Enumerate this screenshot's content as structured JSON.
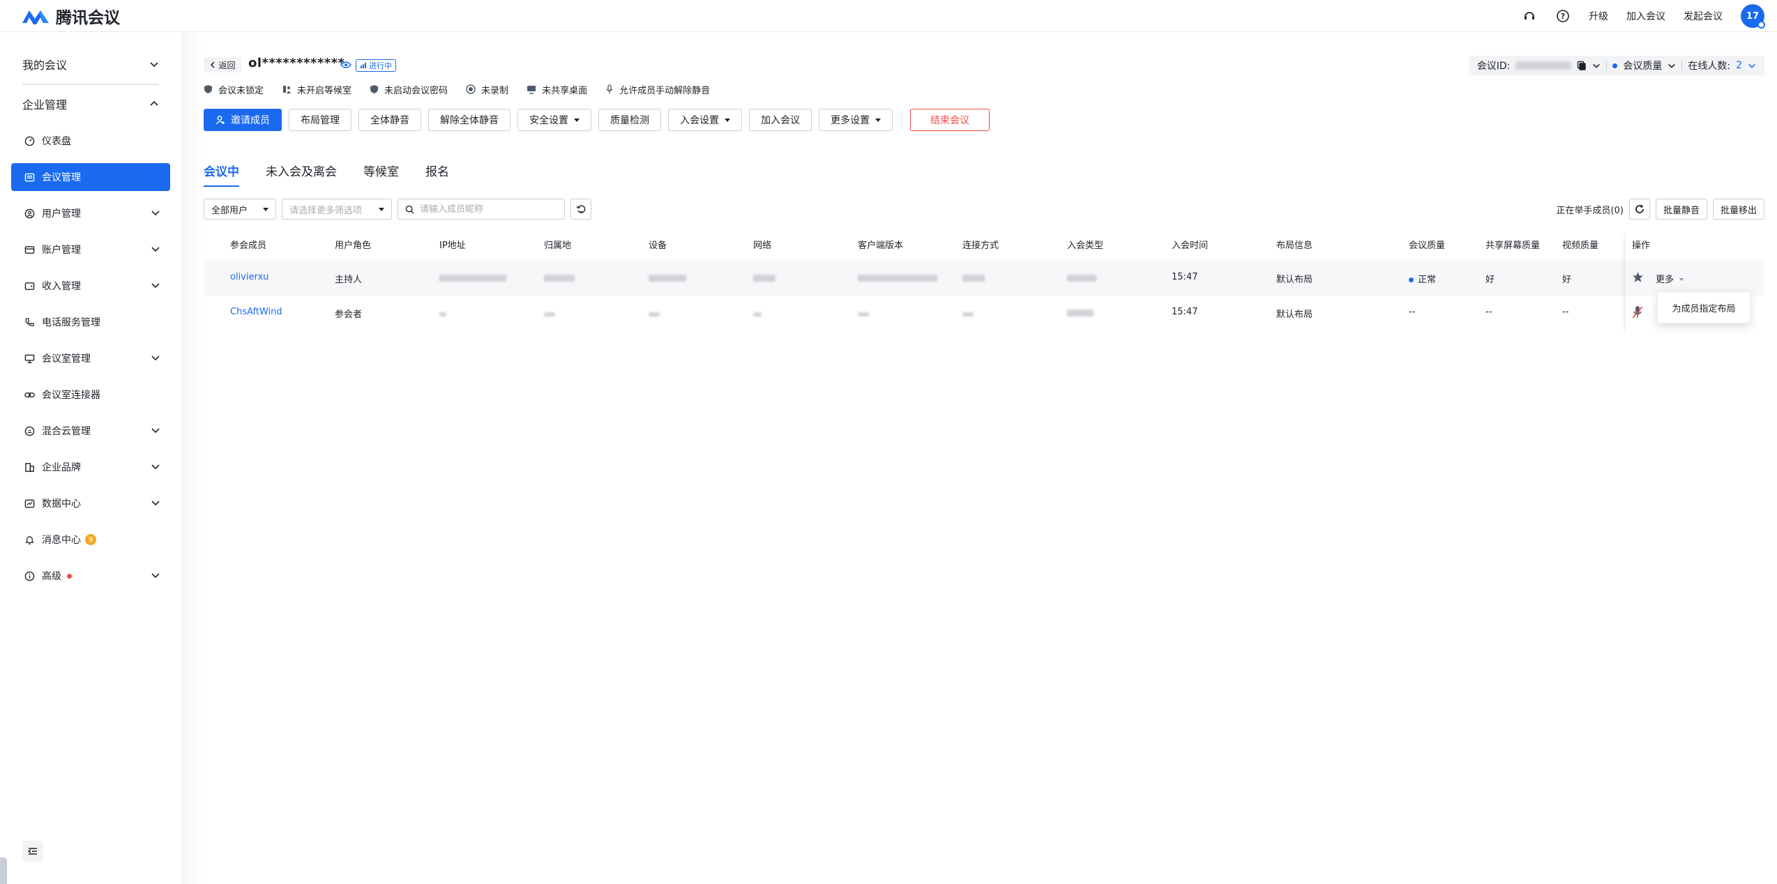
{
  "app": {
    "name": "腾讯会议"
  },
  "topbar": {
    "upgrade": "升级",
    "join_meeting": "加入会议",
    "start_meeting": "发起会议",
    "avatar_text": "17"
  },
  "sidebar": {
    "my_meetings": "我的会议",
    "enterprise_mgmt": "企业管理",
    "items": [
      {
        "label": "仪表盘"
      },
      {
        "label": "会议管理"
      },
      {
        "label": "用户管理"
      },
      {
        "label": "账户管理"
      },
      {
        "label": "收入管理"
      },
      {
        "label": "电话服务管理"
      },
      {
        "label": "会议室管理"
      },
      {
        "label": "会议室连接器"
      },
      {
        "label": "混合云管理"
      },
      {
        "label": "企业品牌"
      },
      {
        "label": "数据中心"
      },
      {
        "label": "消息中心",
        "badge": "9"
      },
      {
        "label": "高级"
      }
    ]
  },
  "meeting": {
    "back": "返回",
    "title": "ol************",
    "status": "进行中",
    "id_label": "会议ID:",
    "quality_label": "会议质量",
    "online_label": "在线人数:",
    "online_count": "2",
    "status_items": [
      "会议未锁定",
      "未开启等候室",
      "未启动会议密码",
      "未录制",
      "未共享桌面",
      "允许成员手动解除静音"
    ]
  },
  "actions": {
    "invite": "邀请成员",
    "layout": "布局管理",
    "mute_all": "全体静音",
    "unmute_all": "解除全体静音",
    "security": "安全设置",
    "quality_check": "质量检测",
    "join_settings": "入会设置",
    "join": "加入会议",
    "more_settings": "更多设置",
    "end": "结束会议"
  },
  "tabs": [
    "会议中",
    "未入会及离会",
    "等候室",
    "报名"
  ],
  "filters": {
    "user_type": "全部用户",
    "more_filters": "请选择更多筛选项",
    "search_placeholder": "请输入成员昵称",
    "raising_hands": "正在举手成员(0)",
    "batch_mute": "批量静音",
    "batch_remove": "批量移出"
  },
  "table": {
    "headers": [
      "参会成员",
      "用户角色",
      "IP地址",
      "归属地",
      "设备",
      "网络",
      "客户端版本",
      "连接方式",
      "入会类型",
      "入会时间",
      "布局信息",
      "会议质量",
      "共享屏幕质量",
      "视频质量",
      "操作"
    ],
    "rows": [
      {
        "name": "olivierxu",
        "role": "主持人",
        "time": "15:47",
        "layout": "默认布局",
        "quality": "正常",
        "share_quality": "好",
        "video_quality": "好",
        "more": "更多"
      },
      {
        "name": "ChsAftWind",
        "role": "参会者",
        "time": "15:47",
        "layout": "默认布局",
        "quality": "--",
        "share_quality": "--",
        "video_quality": "--"
      }
    ]
  },
  "dropdown": {
    "item": "为成员指定布局"
  },
  "colors": {
    "primary": "#1a6af0",
    "danger": "#f54a45"
  }
}
